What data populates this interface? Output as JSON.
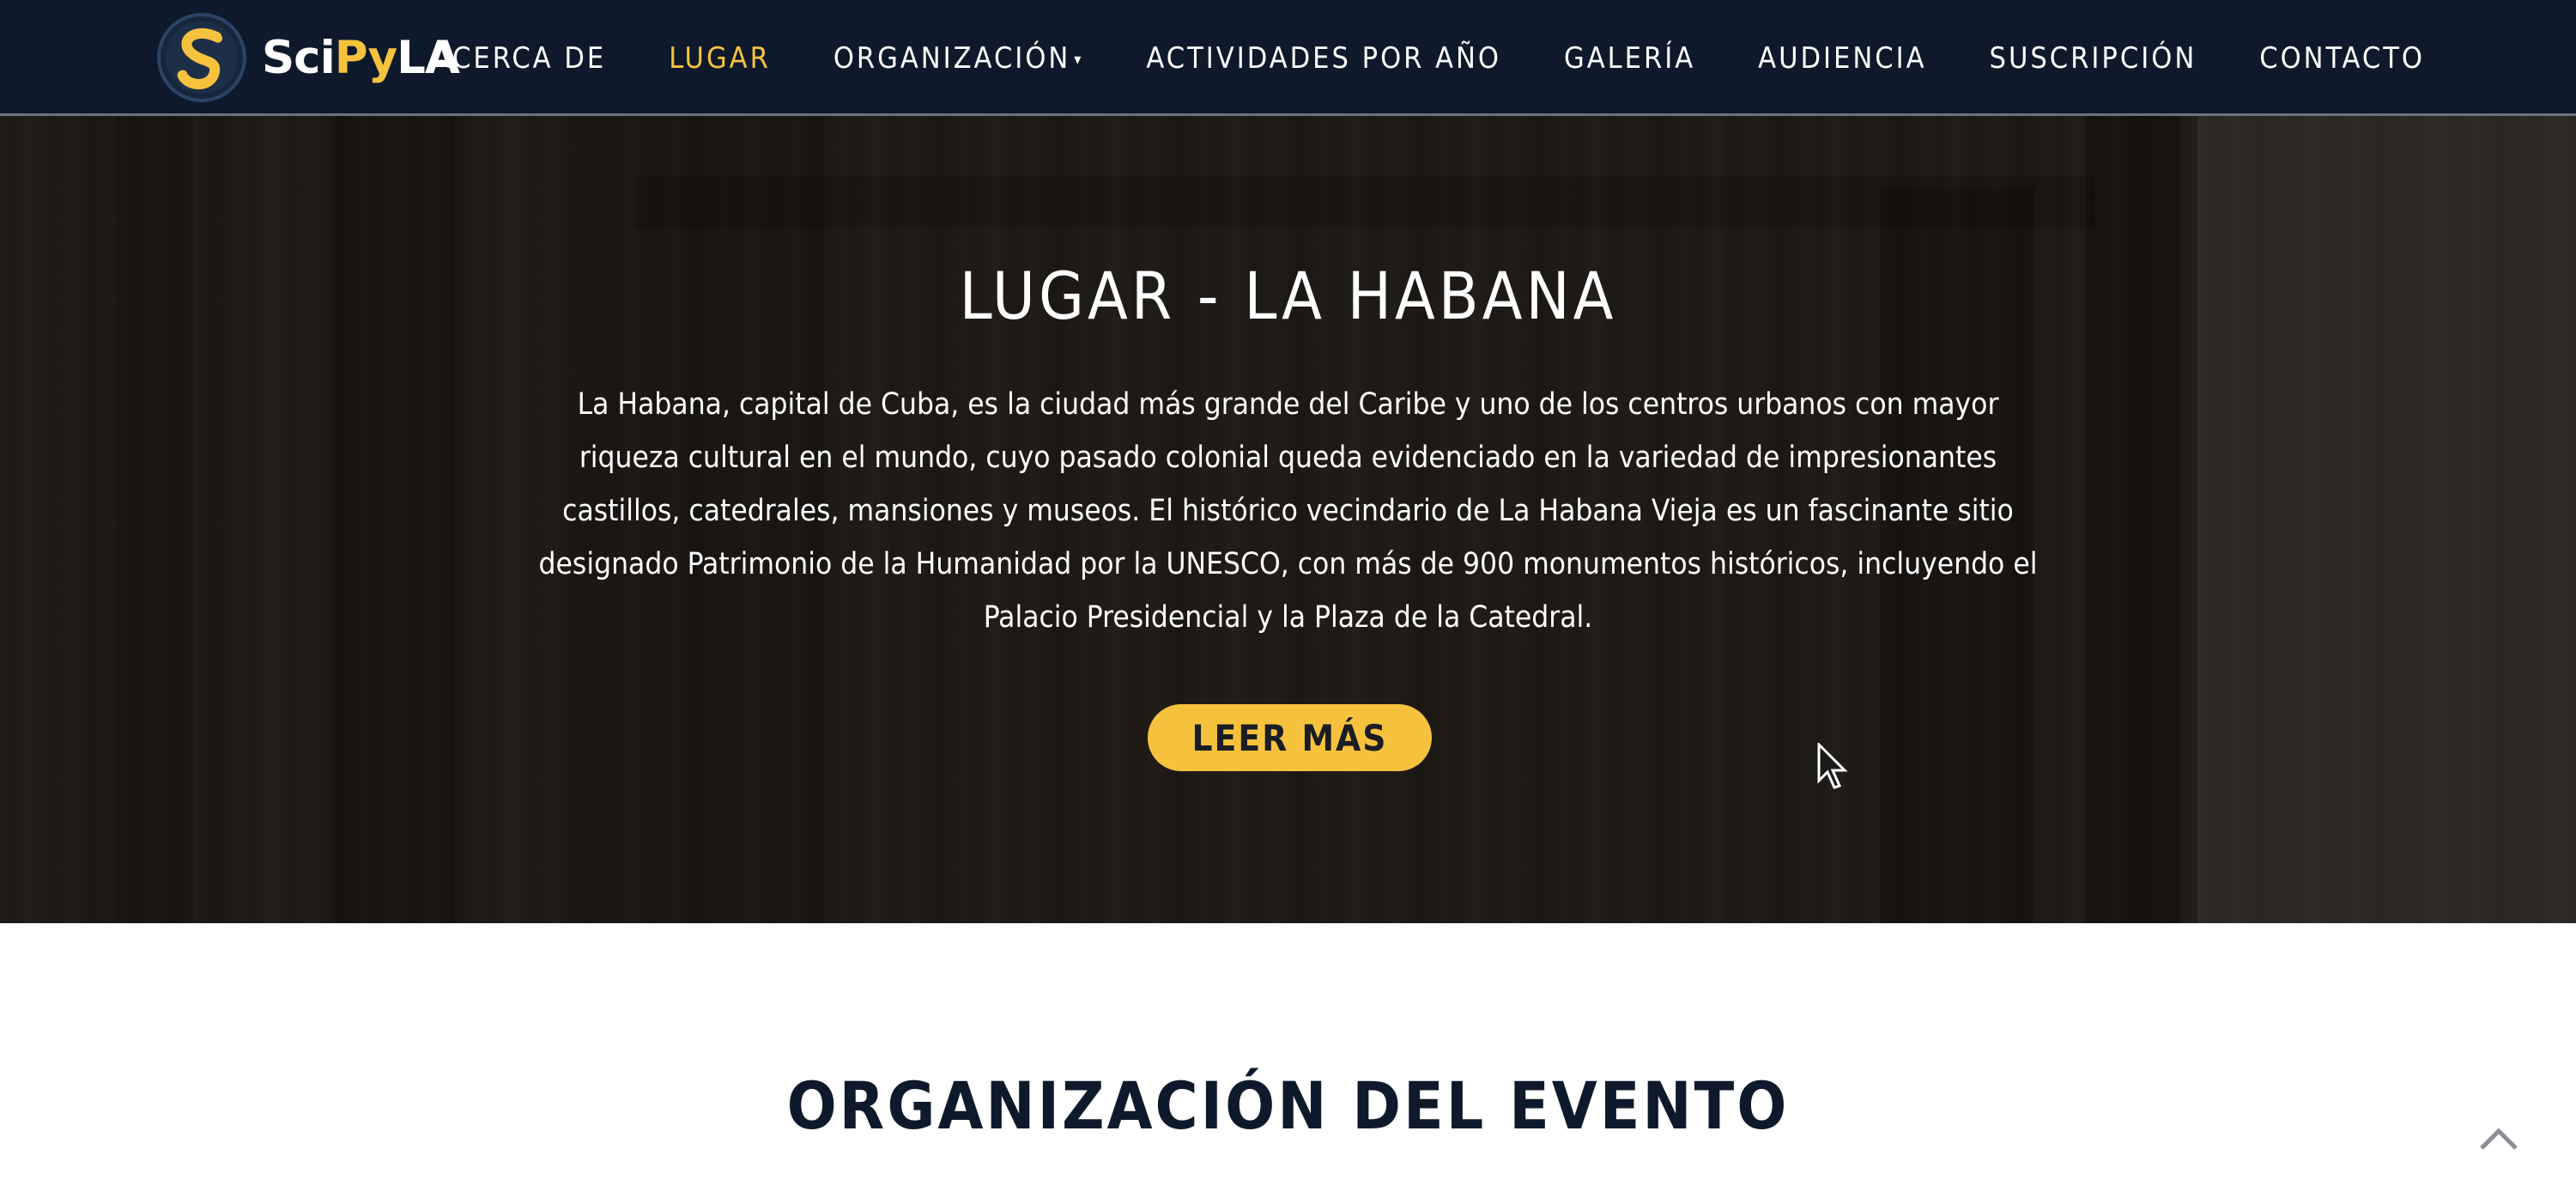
{
  "brand": {
    "logo_part1": "Sci",
    "logo_part2": "Py",
    "logo_part3": "LA",
    "accent_color": "#f6c23e",
    "nav_bg_color": "#0e1a2b"
  },
  "nav": {
    "items": [
      {
        "label": "ACERCA DE"
      },
      {
        "label": "LUGAR"
      },
      {
        "label": "ORGANIZACIÓN"
      },
      {
        "label": "ACTIVIDADES POR AÑO"
      },
      {
        "label": "GALERÍA"
      },
      {
        "label": "AUDIENCIA"
      },
      {
        "label": "SUSCRIPCIÓN"
      },
      {
        "label": "CONTACTO"
      }
    ],
    "active_item": "LUGAR",
    "dropdown_icon": "caret-down-icon"
  },
  "hero": {
    "title": "LUGAR - LA HABANA",
    "text": "La Habana, capital de Cuba, es la ciudad más grande del Caribe y uno de los centros urbanos con mayor riqueza cultural en el mundo, cuyo pasado colonial queda evidenciado en la variedad de impresionantes castillos, catedrales, mansiones y museos. El histórico vecindario de La Habana Vieja es un fascinante sitio designado Patrimonio de la Humanidad por la UNESCO, con más de 900 monumentos históricos, incluyendo el Palacio Presidencial y la Plaza de la Catedral.",
    "button_label": "LEER MÁS"
  },
  "section": {
    "title": "ORGANIZACIÓN DEL EVENTO"
  },
  "scroll_top": {
    "icon": "chevron-up-icon"
  }
}
